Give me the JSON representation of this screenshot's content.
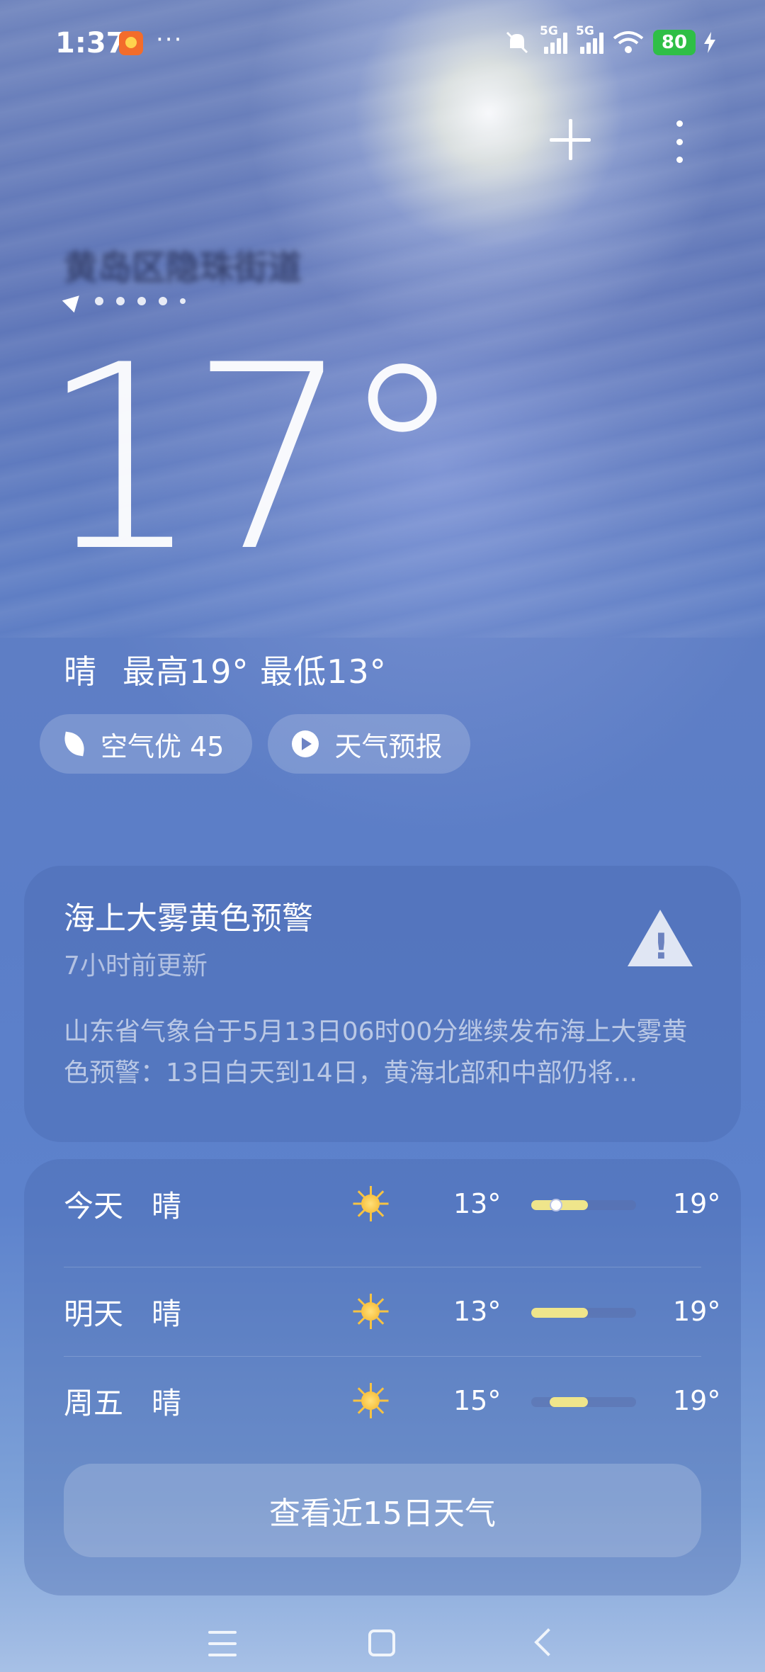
{
  "status_bar": {
    "time": "1:37",
    "more": "···",
    "network_tags": [
      "5G",
      "5G"
    ],
    "battery": "80"
  },
  "location": {
    "name": "黄岛区隐珠街道"
  },
  "current": {
    "temperature": "17°",
    "condition": "晴",
    "high_low": "最高19° 最低13°"
  },
  "chips": {
    "air_quality": "空气优 45",
    "forecast_video": "天气预报"
  },
  "warning": {
    "title": "海上大雾黄色预警",
    "updated": "7小时前更新",
    "body": "山东省气象台于5月13日06时00分继续发布海上大雾黄色预警：13日白天到14日，黄海北部和中部仍将..."
  },
  "forecast": {
    "days": [
      {
        "day": "今天",
        "condition": "晴",
        "icon": "sun-icon",
        "low": "13°",
        "high": "19°"
      },
      {
        "day": "明天",
        "condition": "晴",
        "icon": "sun-icon",
        "low": "13°",
        "high": "19°"
      },
      {
        "day": "周五",
        "condition": "晴",
        "icon": "sun-icon",
        "low": "15°",
        "high": "19°"
      }
    ],
    "more_button": "查看近15日天气"
  },
  "colors": {
    "bar_fill": "#efe58b",
    "battery": "#2fbf46"
  }
}
